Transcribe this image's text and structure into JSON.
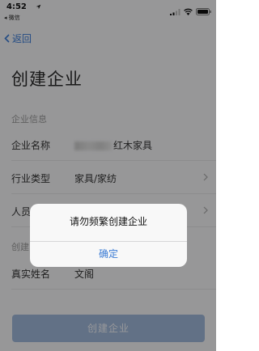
{
  "status_bar": {
    "time": "4:52",
    "back_app": "◂ 微信"
  },
  "nav": {
    "back_label": "返回"
  },
  "page": {
    "title": "创建企业"
  },
  "enterprise_section": {
    "title": "企业信息",
    "name_label": "企业名称",
    "name_value": "红木家具",
    "industry_label": "行业类型",
    "industry_value": "家具/家纺",
    "people_label": "人员"
  },
  "creator_section": {
    "title": "创建",
    "realname_label": "真实姓名",
    "realname_value": "文阁"
  },
  "submit": {
    "label": "创建企业"
  },
  "alert": {
    "message": "请勿频繁创建企业",
    "confirm_label": "确定"
  },
  "colors": {
    "accent": "#3a7bd5",
    "background": "#f4f4f6",
    "overlay": "rgba(0,0,0,0.38)"
  }
}
